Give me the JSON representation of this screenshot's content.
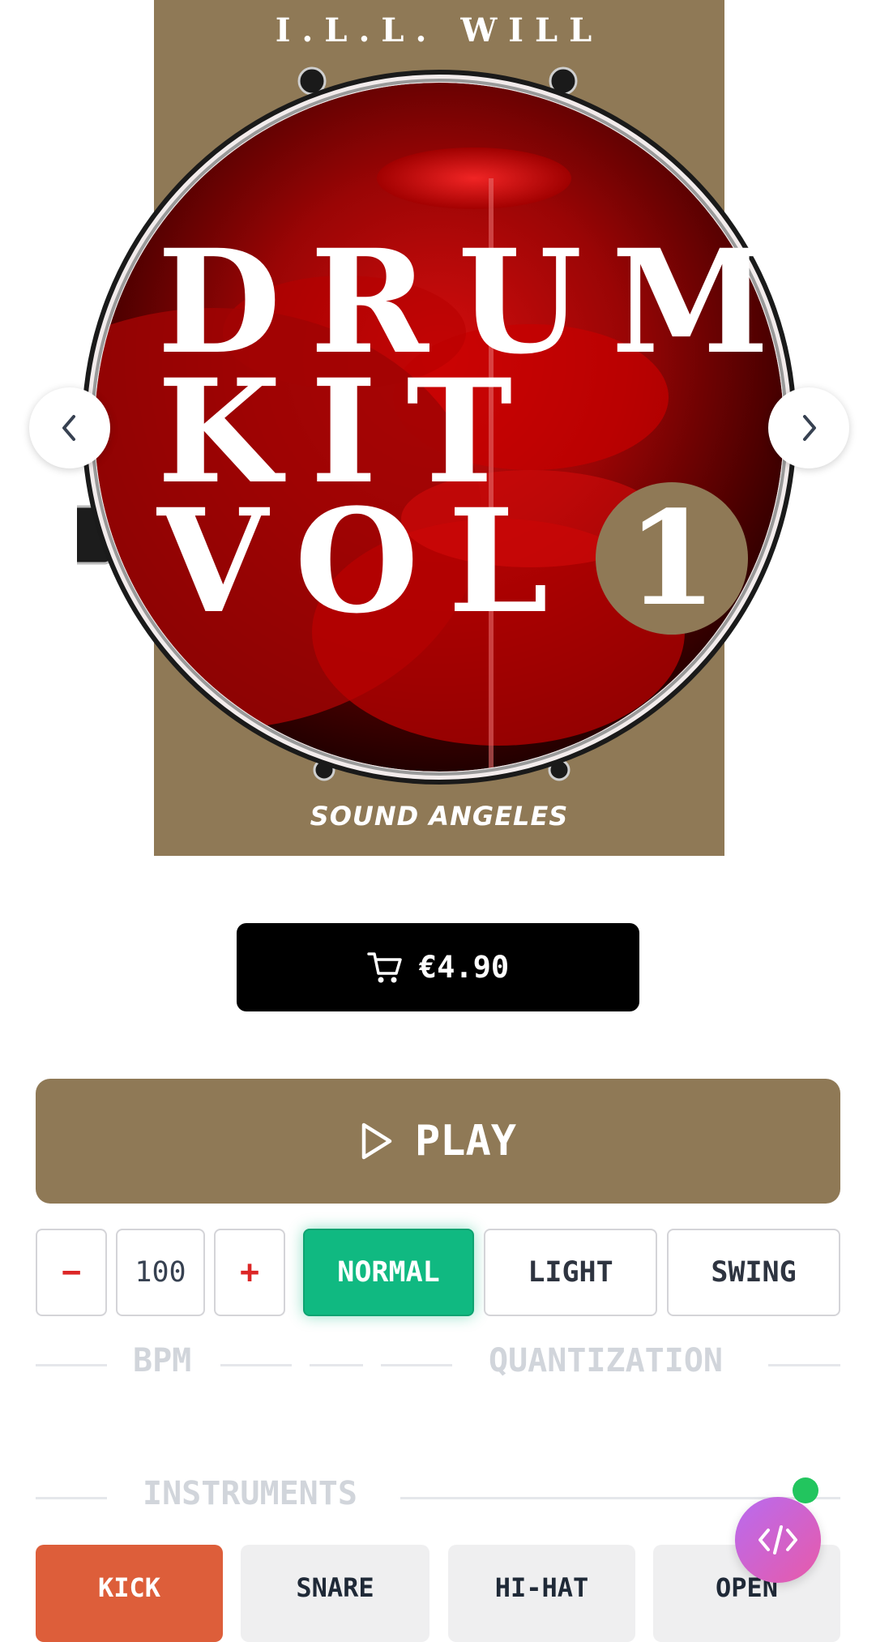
{
  "cover": {
    "artist": "I.L.L. WILL",
    "title_lines": [
      "DRUM",
      "KIT",
      "VOL"
    ],
    "volume_number": "1",
    "brand": "SOUND ANGELES"
  },
  "colors": {
    "cover_background": "#8f7956",
    "play_button": "#8f7956",
    "quantization_active": "#10b981",
    "kick_active": "#dd5e3a",
    "bpm_adjust": "#dc2626",
    "buy_button": "#000000"
  },
  "carousel": {
    "prev_icon": "chevron-left-icon",
    "next_icon": "chevron-right-icon"
  },
  "buy": {
    "price": "€4.90",
    "icon": "cart-icon"
  },
  "player": {
    "play_label": "PLAY",
    "icon": "play-icon"
  },
  "bpm": {
    "minus_label": "−",
    "value": "100",
    "plus_label": "+",
    "section_label": "BPM"
  },
  "quantization": {
    "options": [
      "NORMAL",
      "LIGHT",
      "SWING"
    ],
    "selected": "NORMAL",
    "section_label": "QUANTIZATION"
  },
  "instruments": {
    "section_label": "INSTRUMENTS",
    "items": [
      "KICK",
      "SNARE",
      "HI-HAT",
      "OPEN"
    ],
    "selected": "KICK"
  },
  "dev_fab": {
    "icon": "code-icon",
    "status": "online"
  }
}
